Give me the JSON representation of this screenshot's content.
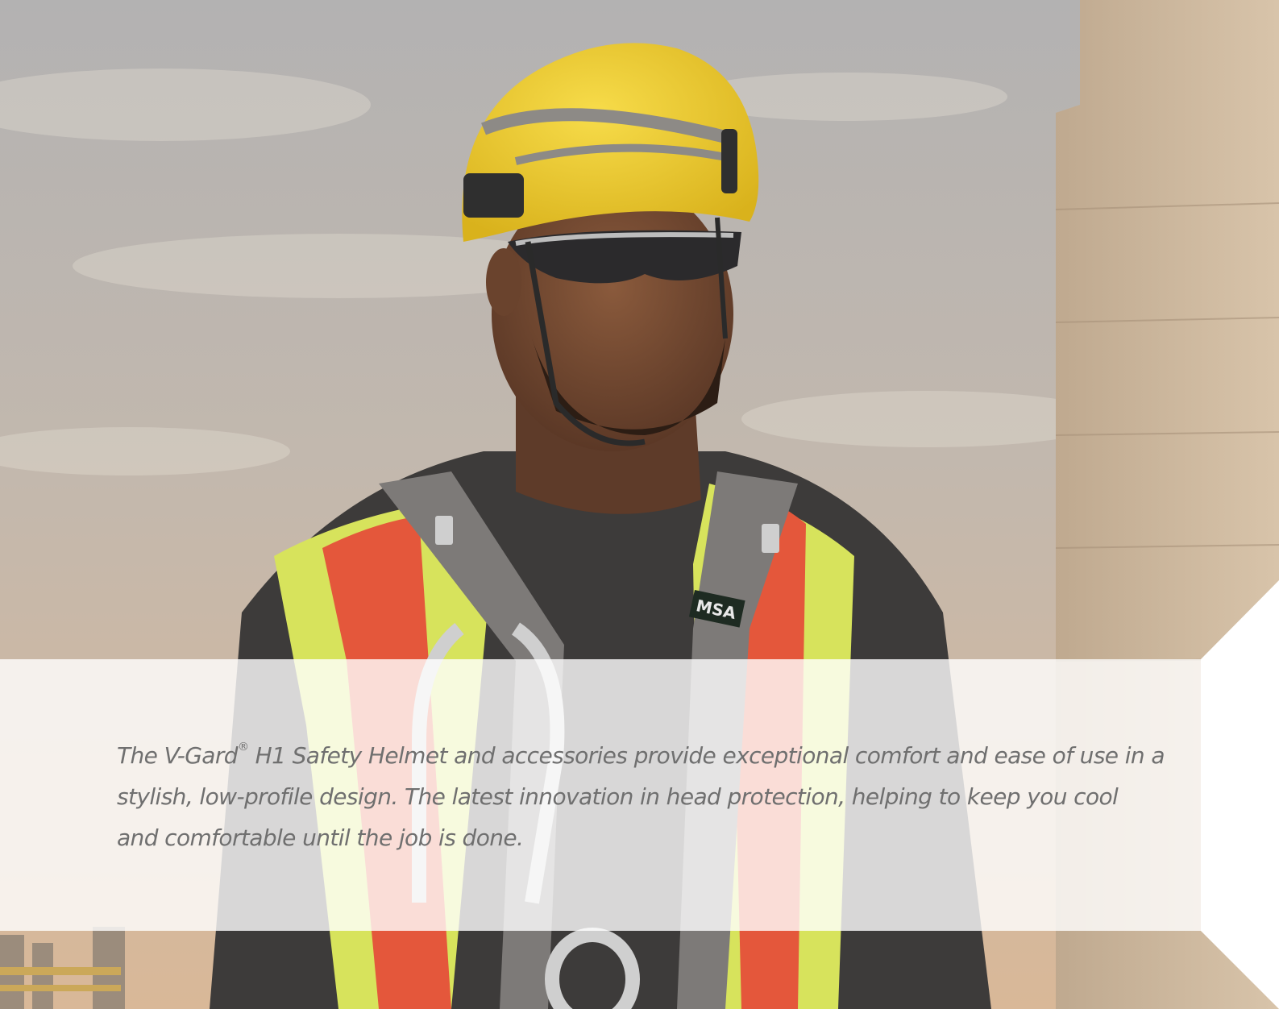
{
  "caption": {
    "part1": "The V-Gard",
    "registered_mark": "®",
    "part2": " H1 Safety Helmet and accessories provide exceptional comfort and ease of use in a stylish, low-profile design. The latest innovation in head protection, helping to keep you cool and comfortable until the job is done."
  },
  "photo": {
    "subject": "worker-with-yellow-helmet",
    "logo_text": "MSA"
  },
  "colors": {
    "sky_top": "#b9b6b2",
    "sky_bottom": "#d3b79c",
    "helmet_yellow": "#f2cf2e",
    "vest_orange": "#e8553a",
    "vest_lime": "#d8e85a",
    "concrete": "#c8b39a",
    "caption_text": "#6f6f6f"
  }
}
